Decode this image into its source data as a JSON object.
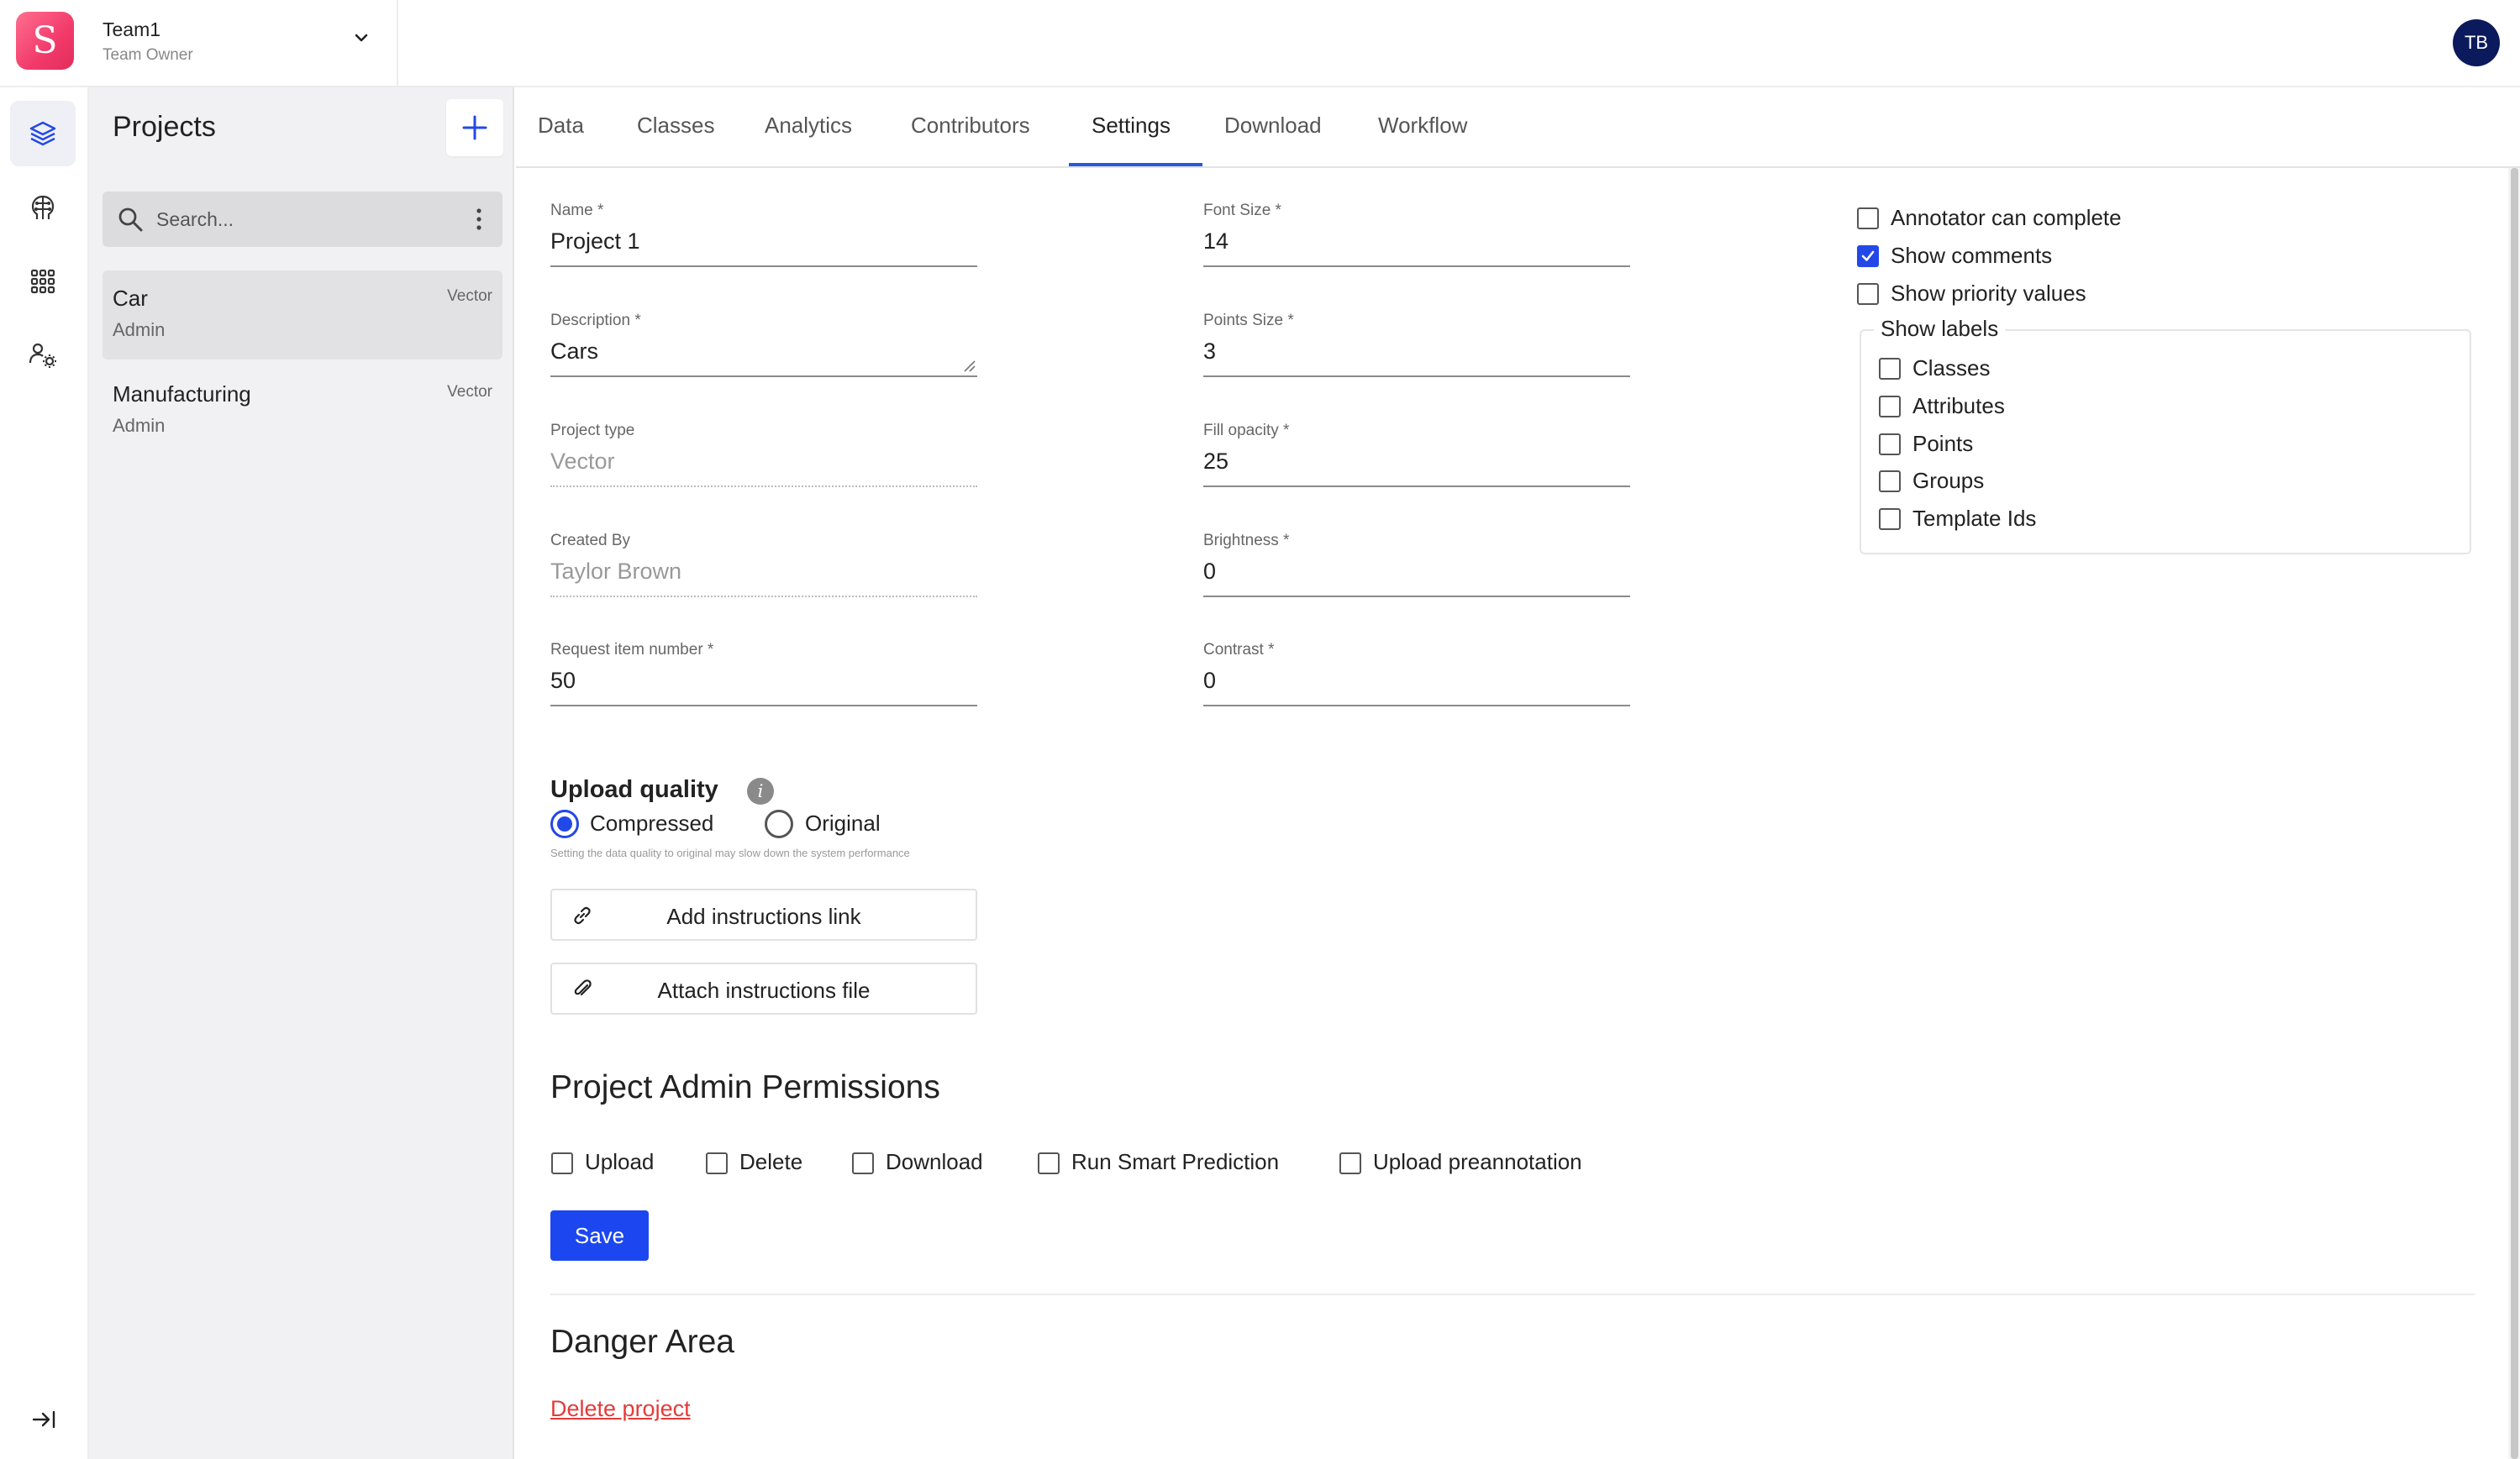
{
  "header": {
    "logo_letter": "S",
    "team_name": "Team1",
    "team_role": "Team Owner",
    "avatar_initials": "TB"
  },
  "rail": {
    "items": [
      "layers-icon",
      "brain-icon",
      "grid-icon",
      "users-gear-icon"
    ],
    "collapse": "collapse-icon"
  },
  "projects": {
    "title": "Projects",
    "search_placeholder": "Search...",
    "items": [
      {
        "name": "Car",
        "role": "Admin",
        "type": "Vector"
      },
      {
        "name": "Manufacturing",
        "role": "Admin",
        "type": "Vector"
      }
    ]
  },
  "tabs": [
    "Data",
    "Classes",
    "Analytics",
    "Contributors",
    "Settings",
    "Download",
    "Workflow"
  ],
  "active_tab": "Settings",
  "form": {
    "name": {
      "label": "Name *",
      "value": "Project 1"
    },
    "description": {
      "label": "Description *",
      "value": "Cars"
    },
    "project_type": {
      "label": "Project type",
      "value": "Vector"
    },
    "created_by": {
      "label": "Created By",
      "value": "Taylor Brown"
    },
    "request_item_number": {
      "label": "Request item number *",
      "value": "50"
    },
    "font_size": {
      "label": "Font Size *",
      "value": "14"
    },
    "points_size": {
      "label": "Points Size *",
      "value": "3"
    },
    "fill_opacity": {
      "label": "Fill opacity *",
      "value": "25"
    },
    "brightness": {
      "label": "Brightness *",
      "value": "0"
    },
    "contrast": {
      "label": "Contrast *",
      "value": "0"
    }
  },
  "upload_quality": {
    "title": "Upload quality",
    "options": [
      "Compressed",
      "Original"
    ],
    "selected": "Compressed",
    "hint": "Setting the data quality to original may slow down the system performance"
  },
  "buttons": {
    "add_instructions_link": "Add instructions link",
    "attach_instructions_file": "Attach instructions file",
    "save": "Save"
  },
  "options": {
    "annotator_can_complete": {
      "label": "Annotator can complete",
      "checked": false
    },
    "show_comments": {
      "label": "Show comments",
      "checked": true
    },
    "show_priority_values": {
      "label": "Show priority values",
      "checked": false
    }
  },
  "show_labels": {
    "title": "Show labels",
    "items": [
      {
        "label": "Classes",
        "checked": false
      },
      {
        "label": "Attributes",
        "checked": false
      },
      {
        "label": "Points",
        "checked": false
      },
      {
        "label": "Groups",
        "checked": false
      },
      {
        "label": "Template Ids",
        "checked": false
      }
    ]
  },
  "permissions": {
    "title": "Project Admin Permissions",
    "items": [
      {
        "label": "Upload",
        "checked": false
      },
      {
        "label": "Delete",
        "checked": false
      },
      {
        "label": "Download",
        "checked": false
      },
      {
        "label": "Run Smart Prediction",
        "checked": false
      },
      {
        "label": "Upload preannotation",
        "checked": false
      }
    ]
  },
  "danger": {
    "title": "Danger Area",
    "delete_link": "Delete project"
  },
  "colors": {
    "accent": "#2348e8",
    "save_button": "#1c47f0",
    "danger": "#e33b3b",
    "avatar_bg": "#0b1a5c",
    "logo_gradient": "#f23a6b"
  }
}
